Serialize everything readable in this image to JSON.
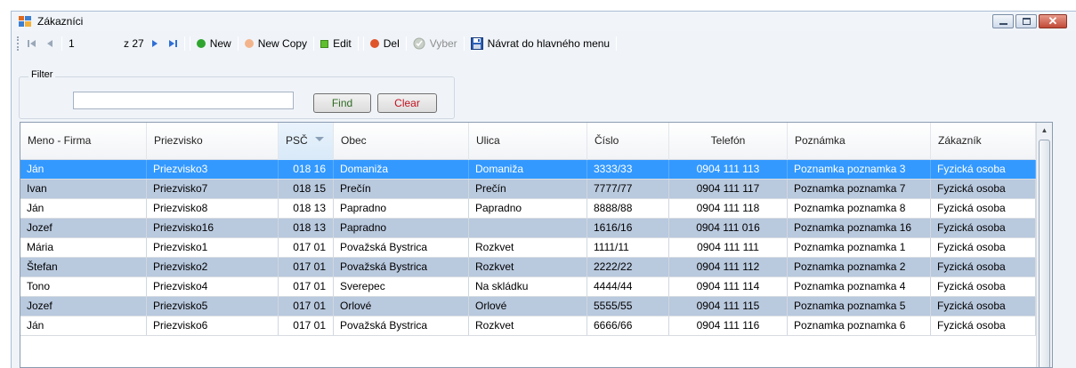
{
  "window": {
    "title": "Zákazníci",
    "icon": "app-window-icon"
  },
  "toolbar": {
    "position_value": "1",
    "position_of": "z 27",
    "new_label": "New",
    "new_copy_label": "New Copy",
    "edit_label": "Edit",
    "del_label": "Del",
    "vyber_label": "Vyber",
    "navrat_label": "Návrat do hlavného menu",
    "colors": {
      "new": "#2fa52f",
      "new_copy": "#f3b48c",
      "edit": "#5fbf2f",
      "del": "#e0542a",
      "vyber": "#b9c1b7"
    }
  },
  "filter": {
    "legend": "Filter",
    "input_value": "",
    "find_label": "Find",
    "clear_label": "Clear"
  },
  "grid": {
    "columns": [
      "Meno - Firma",
      "Priezvisko",
      "PSČ",
      "Obec",
      "Ulica",
      "Číslo",
      "Telefón",
      "Poznámka",
      "Zákazník"
    ],
    "sorted_column": "PSČ",
    "selected_row_color": "#3399ff",
    "alt_row_color": "#b9c9de",
    "rows": [
      [
        "Ján",
        "Priezvisko3",
        "018 16",
        "Domaniža",
        "Domaniža",
        "3333/33",
        "0904 111 113",
        "Poznamka poznamka 3",
        "Fyzická osoba"
      ],
      [
        "Ivan",
        "Priezvisko7",
        "018 15",
        "Prečín",
        "Prečín",
        "7777/77",
        "0904 111 117",
        "Poznamka poznamka 7",
        "Fyzická osoba"
      ],
      [
        "Ján",
        "Priezvisko8",
        "018 13",
        "Papradno",
        "Papradno",
        "8888/88",
        "0904 111 118",
        "Poznamka poznamka 8",
        "Fyzická osoba"
      ],
      [
        "Jozef",
        "Priezvisko16",
        "018 13",
        "Papradno",
        "",
        "1616/16",
        "0904 111 016",
        "Poznamka poznamka 16",
        "Fyzická osoba"
      ],
      [
        "Mária",
        "Priezvisko1",
        "017 01",
        "Považská Bystrica",
        "Rozkvet",
        "1111/11",
        "0904 111 111",
        "Poznamka poznamka 1",
        "Fyzická osoba"
      ],
      [
        "Štefan",
        "Priezvisko2",
        "017 01",
        "Považská Bystrica",
        "Rozkvet",
        "2222/22",
        "0904 111 112",
        "Poznamka poznamka 2",
        "Fyzická osoba"
      ],
      [
        "Tono",
        "Priezvisko4",
        "017 01",
        "Sverepec",
        "Na skládku",
        "4444/44",
        "0904 111 114",
        "Poznamka poznamka 4",
        "Fyzická osoba"
      ],
      [
        "Jozef",
        "Priezvisko5",
        "017 01",
        "Orlové",
        "Orlové",
        "5555/55",
        "0904 111 115",
        "Poznamka poznamka 5",
        "Fyzická osoba"
      ],
      [
        "Ján",
        "Priezvisko6",
        "017 01",
        "Považská Bystrica",
        "Rozkvet",
        "6666/66",
        "0904 111 116",
        "Poznamka poznamka 6",
        "Fyzická osoba"
      ]
    ]
  }
}
